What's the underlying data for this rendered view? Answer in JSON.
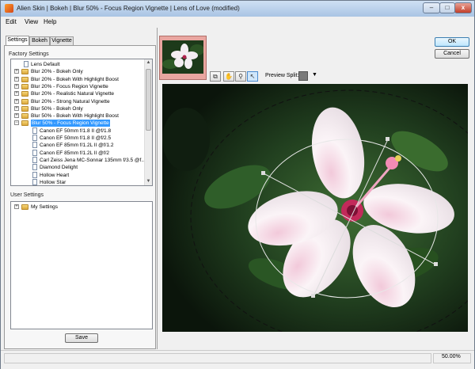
{
  "window": {
    "title": "Alien Skin | Bokeh | Blur 50% - Focus Region Vignette | Lens of Love (modified)"
  },
  "titlebar_buttons": {
    "minimize": "–",
    "maximize": "□",
    "close": "x"
  },
  "menu": [
    "Edit",
    "View",
    "Help"
  ],
  "tabs": [
    "Settings",
    "Bokeh",
    "Vignette"
  ],
  "factory_settings": {
    "label": "Factory Settings",
    "items": [
      {
        "label": "Lens Default",
        "type": "doc",
        "indent": 0
      },
      {
        "label": "Blur 20% - Bokeh Only",
        "type": "folder",
        "indent": 0
      },
      {
        "label": "Blur 20% - Bokeh With Highlight Boost",
        "type": "folder",
        "indent": 0
      },
      {
        "label": "Blur 20% - Focus Region Vignette",
        "type": "folder",
        "indent": 0
      },
      {
        "label": "Blur 20% - Realistic Natural Vignette",
        "type": "folder",
        "indent": 0
      },
      {
        "label": "Blur 20% - Strong Natural Vignette",
        "type": "folder",
        "indent": 0
      },
      {
        "label": "Blur 50% - Bokeh Only",
        "type": "folder",
        "indent": 0
      },
      {
        "label": "Blur 50% - Bokeh With Highlight Boost",
        "type": "folder",
        "indent": 0
      },
      {
        "label": "Blur 50% - Focus Region Vignette",
        "type": "folder",
        "indent": 0,
        "selected": true
      },
      {
        "label": "Canon EF 50mm f/1.8 II @f/1.8",
        "type": "doc",
        "indent": 1
      },
      {
        "label": "Canon EF 50mm f/1.8 II @f/2.5",
        "type": "doc",
        "indent": 1
      },
      {
        "label": "Canon EF 85mm f/1.2L II @f/1.2",
        "type": "doc",
        "indent": 1
      },
      {
        "label": "Canon EF 85mm f/1.2L II @f/2",
        "type": "doc",
        "indent": 1
      },
      {
        "label": "Carl Zeiss Jena MC-Sonnar 135mm f/3.5 @f...",
        "type": "doc",
        "indent": 1
      },
      {
        "label": "Diamond Delight",
        "type": "doc",
        "indent": 1
      },
      {
        "label": "Hollow Heart",
        "type": "doc",
        "indent": 1
      },
      {
        "label": "Hollow Star",
        "type": "doc",
        "indent": 1
      }
    ]
  },
  "user_settings": {
    "label": "User Settings",
    "items": [
      {
        "label": "My Settings",
        "type": "folder"
      }
    ]
  },
  "buttons": {
    "save": "Save",
    "ok": "OK",
    "cancel": "Cancel"
  },
  "toolbar": {
    "preview_split_label": "Preview Split:",
    "tools": [
      {
        "name": "compare-icon",
        "glyph": "⧉"
      },
      {
        "name": "hand-icon",
        "glyph": "✋"
      },
      {
        "name": "zoom-icon",
        "glyph": "🔍"
      },
      {
        "name": "pointer-icon",
        "glyph": "↖"
      }
    ]
  },
  "status": {
    "zoom": "50.00%"
  },
  "colors": {
    "selection": "#3399ff",
    "thumb_border": "#e9a6a0"
  }
}
